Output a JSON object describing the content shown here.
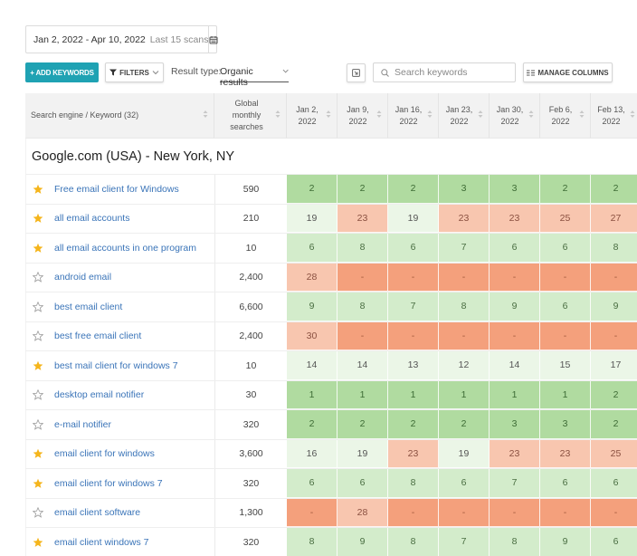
{
  "date_range": {
    "range": "Jan 2, 2022 - Apr 10, 2022",
    "scans": "Last 15 scans",
    "calendar_icon": "calendar-icon"
  },
  "toolbar": {
    "add_keywords_label": "+ ADD KEYWORDS",
    "filters_label": "FILTERS",
    "result_type_label": "Result type:",
    "result_type_value": "Organic results",
    "export_icon": "export-icon",
    "search_placeholder": "Search keywords",
    "search_value": "",
    "manage_columns_label": "MANAGE COLUMNS"
  },
  "table": {
    "header": {
      "keyword": "Search engine / Keyword (32)",
      "global_searches": [
        "Global",
        "monthly",
        "searches"
      ],
      "dates": [
        [
          "Jan 2,",
          "2022"
        ],
        [
          "Jan 9,",
          "2022"
        ],
        [
          "Jan 16,",
          "2022"
        ],
        [
          "Jan 23,",
          "2022"
        ],
        [
          "Jan 30,",
          "2022"
        ],
        [
          "Feb 6,",
          "2022"
        ],
        [
          "Feb 13,",
          "2022"
        ]
      ]
    },
    "group": "Google.com (USA) - New York, NY",
    "rows": [
      {
        "starred": true,
        "keyword": "Free email client for Windows",
        "searches": "590",
        "ranks": [
          "2",
          "2",
          "2",
          "3",
          "3",
          "2",
          "2"
        ]
      },
      {
        "starred": true,
        "keyword": "all email accounts",
        "searches": "210",
        "ranks": [
          "19",
          "23",
          "19",
          "23",
          "23",
          "25",
          "27"
        ]
      },
      {
        "starred": true,
        "keyword": "all email accounts in one program",
        "searches": "10",
        "ranks": [
          "6",
          "8",
          "6",
          "7",
          "6",
          "6",
          "8"
        ]
      },
      {
        "starred": false,
        "keyword": "android email",
        "searches": "2,400",
        "ranks": [
          "28",
          "-",
          "-",
          "-",
          "-",
          "-",
          "-"
        ]
      },
      {
        "starred": false,
        "keyword": "best email client",
        "searches": "6,600",
        "ranks": [
          "9",
          "8",
          "7",
          "8",
          "9",
          "6",
          "9"
        ]
      },
      {
        "starred": false,
        "keyword": "best free email client",
        "searches": "2,400",
        "ranks": [
          "30",
          "-",
          "-",
          "-",
          "-",
          "-",
          "-"
        ]
      },
      {
        "starred": true,
        "keyword": "best mail client for windows 7",
        "searches": "10",
        "ranks": [
          "14",
          "14",
          "13",
          "12",
          "14",
          "15",
          "17"
        ]
      },
      {
        "starred": false,
        "keyword": "desktop email notifier",
        "searches": "30",
        "ranks": [
          "1",
          "1",
          "1",
          "1",
          "1",
          "1",
          "2"
        ]
      },
      {
        "starred": false,
        "keyword": "e-mail notifier",
        "searches": "320",
        "ranks": [
          "2",
          "2",
          "2",
          "2",
          "3",
          "3",
          "2"
        ]
      },
      {
        "starred": true,
        "keyword": "email client for windows",
        "searches": "3,600",
        "ranks": [
          "16",
          "19",
          "23",
          "19",
          "23",
          "23",
          "25"
        ]
      },
      {
        "starred": true,
        "keyword": "email client for windows 7",
        "searches": "320",
        "ranks": [
          "6",
          "6",
          "8",
          "6",
          "7",
          "6",
          "6"
        ]
      },
      {
        "starred": false,
        "keyword": "email client software",
        "searches": "1,300",
        "ranks": [
          "-",
          "28",
          "-",
          "-",
          "-",
          "-",
          "-"
        ]
      },
      {
        "starred": true,
        "keyword": "email client windows 7",
        "searches": "320",
        "ranks": [
          "8",
          "9",
          "8",
          "7",
          "8",
          "9",
          "6"
        ]
      }
    ]
  },
  "colors": {
    "accent": "#1fa2b3",
    "link": "#3a74b8",
    "star_filled": "#f5b51c",
    "rank_top": "#b0dba0",
    "rank_good": "#d3eccb",
    "rank_mid": "#ebf6e7",
    "rank_low": "#f8c6af",
    "rank_none": "#f4a07c"
  }
}
